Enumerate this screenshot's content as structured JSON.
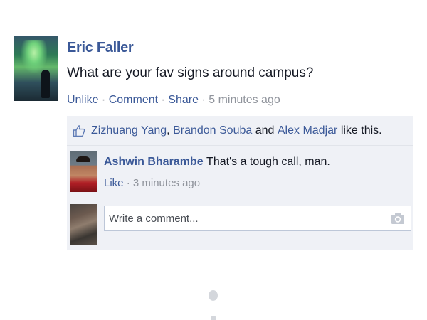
{
  "post": {
    "author": "Eric Faller",
    "message": "What are your fav signs around campus?",
    "actions": {
      "unlike": "Unlike",
      "comment": "Comment",
      "share": "Share",
      "separator": "·",
      "timestamp": "5 minutes ago"
    }
  },
  "likes": {
    "names": [
      "Zizhuang Yang",
      "Brandon Souba",
      "Alex Madjar"
    ],
    "connector_comma": ",",
    "connector_and": "and",
    "suffix": "like this."
  },
  "comments": [
    {
      "author": "Ashwin Bharambe",
      "text": "That's a tough call, man.",
      "like_label": "Like",
      "separator": "·",
      "timestamp": "3 minutes ago"
    }
  ],
  "comment_input": {
    "placeholder": "Write a comment...",
    "value": ""
  },
  "icons": {
    "like": "thumbs-up-icon",
    "camera": "camera-icon"
  },
  "colors": {
    "link": "#3b5998",
    "muted": "#90949c",
    "ufi_background": "#eff1f6"
  }
}
